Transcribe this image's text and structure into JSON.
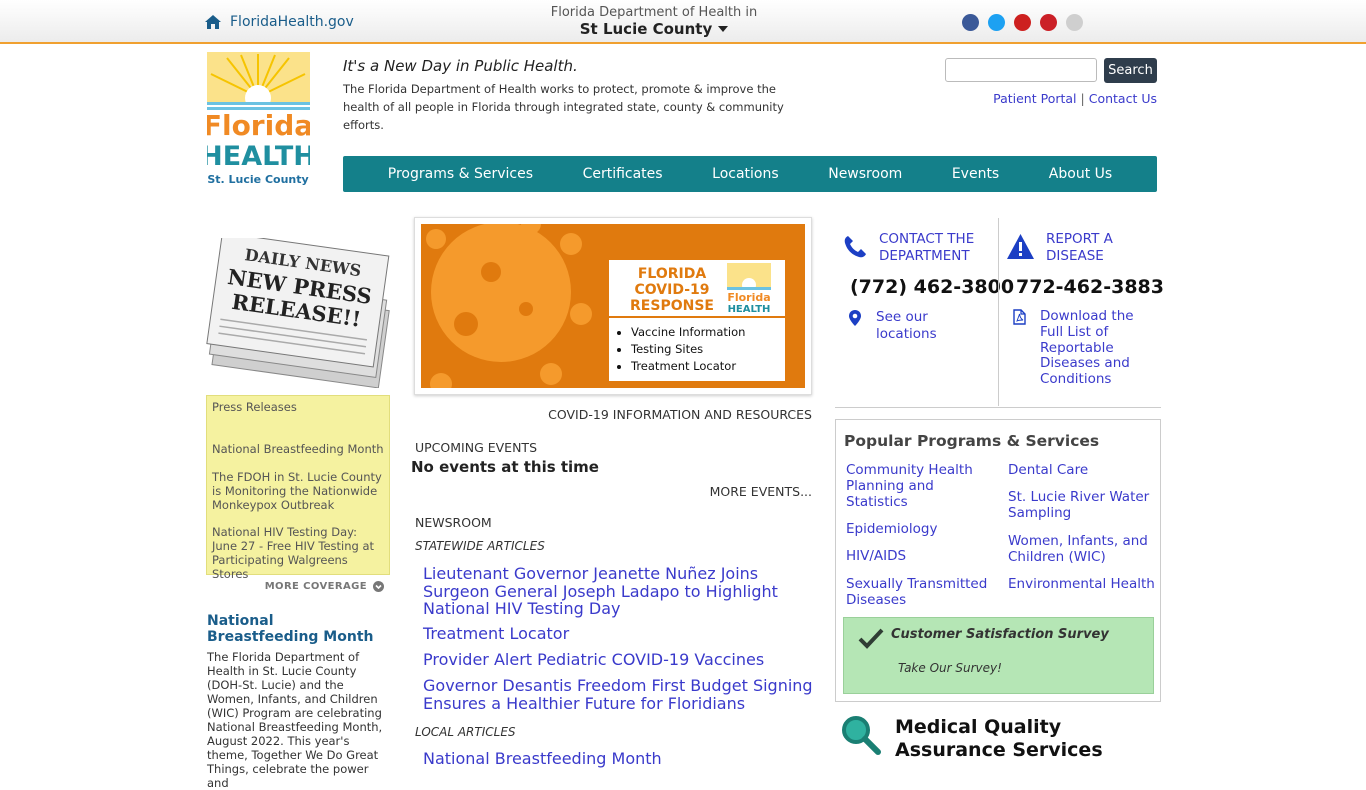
{
  "topbar": {
    "home_label": "FloridaHealth.gov",
    "dept_line1": "Florida Department of Health in",
    "dept_line2": "St Lucie County",
    "social_colors": [
      "#3b5998",
      "#1da1f2",
      "#cd201f",
      "#cb2027",
      "#ff0084"
    ]
  },
  "header": {
    "logo_alt": "Florida HEALTH St. Lucie County",
    "tagline": "It's a New Day in Public Health.",
    "mission": "The Florida Department of Health works to protect, promote & improve the health of all people in Florida through integrated state, county & community efforts.",
    "search_placeholder": "",
    "search_button": "Search",
    "link_patient_portal": "Patient Portal",
    "link_separator": "|",
    "link_contact": "Contact Us"
  },
  "nav": [
    "Programs & Services",
    "Certificates",
    "Locations",
    "Newsroom",
    "Events",
    "About Us"
  ],
  "left": {
    "news_image_text": [
      "DAILY NEWS",
      "NEW PRESS",
      "RELEASE!!"
    ],
    "press_heading": "Press Releases",
    "press_items": [
      "National Breastfeeding Month",
      "The FDOH in St. Lucie County is Monitoring the Nationwide Monkeypox Outbreak",
      "National HIV Testing Day: June 27 - Free HIV Testing at Participating Walgreens Stores"
    ],
    "more_coverage": "MORE COVERAGE",
    "feature_title": "National Breastfeeding Month",
    "feature_body": "The Florida Department of Health in St. Lucie County (DOH-St. Lucie) and the Women, Infants, and Children (WIC) Program are celebrating National Breastfeeding Month, August 2022. This year's theme, Together We Do Great Things, celebrate the power and"
  },
  "center": {
    "covid_banner_title": "FLORIDA COVID-19 RESPONSE",
    "covid_banner_logo": "Florida HEALTH",
    "covid_banner_list": [
      "Vaccine Information",
      "Testing Sites",
      "Treatment Locator"
    ],
    "covid_caption": "COVID-19 INFORMATION AND RESOURCES",
    "upcoming_label": "UPCOMING EVENTS",
    "no_events": "No events at this time",
    "more_events": "MORE EVENTS...",
    "newsroom_label": "NEWSROOM",
    "statewide_label": "STATEWIDE ARTICLES",
    "statewide_articles": [
      "Lieutenant Governor Jeanette Nuñez Joins Surgeon General Joseph Ladapo to Highlight National HIV Testing Day",
      "Treatment Locator",
      "Provider Alert Pediatric COVID-19 Vaccines",
      "Governor Desantis Freedom First Budget Signing Ensures a Healthier Future for Floridians"
    ],
    "local_label": "LOCAL ARTICLES",
    "local_articles": [
      "National Breastfeeding Month"
    ]
  },
  "right": {
    "contact_heading": "CONTACT THE DEPARTMENT",
    "contact_phone": "(772) 462-3800",
    "locations_link": "See our locations",
    "report_heading": "REPORT A DISEASE",
    "report_phone": "772-462-3883",
    "report_link": "Download the Full List of Reportable Diseases and Conditions",
    "popular_title": "Popular Programs & Services",
    "programs_left": [
      "Community Health Planning and Statistics",
      "Epidemiology",
      "HIV/AIDS",
      "Sexually Transmitted Diseases"
    ],
    "programs_right": [
      "Dental Care",
      "St. Lucie River Water Sampling",
      "Women, Infants, and Children (WIC)",
      "Environmental Health"
    ],
    "survey_title": "Customer Satisfaction Survey",
    "survey_link": "Take Our Survey!",
    "mqa_title": "Medical Quality Assurance Services"
  }
}
